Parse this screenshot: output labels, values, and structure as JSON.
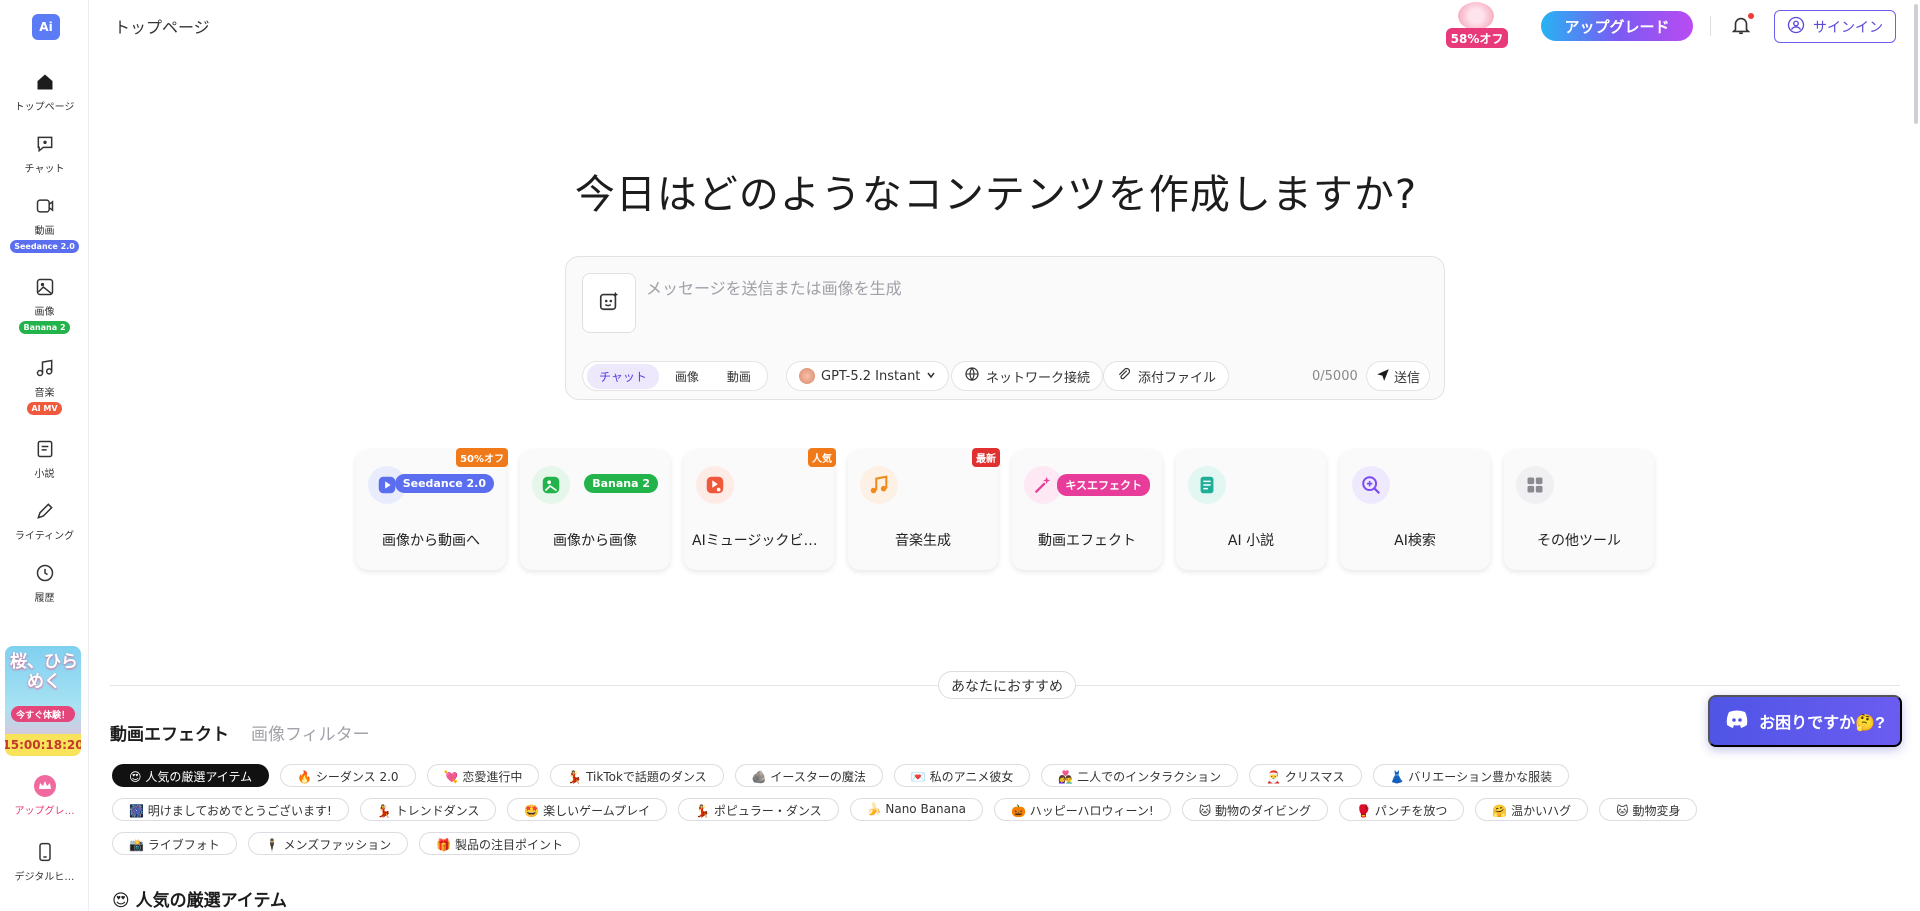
{
  "sidebar": {
    "logo": "Ai",
    "items": [
      {
        "label": "トップページ",
        "icon": "home-icon"
      },
      {
        "label": "チャット",
        "icon": "chat-icon"
      },
      {
        "label": "動画",
        "icon": "video-icon",
        "badge": "Seedance 2.0",
        "badge_color": "#5b6ef0"
      },
      {
        "label": "画像",
        "icon": "image-icon",
        "badge": "Banana 2",
        "badge_color": "#22b34a"
      },
      {
        "label": "音楽",
        "icon": "music-icon",
        "badge": "AI MV",
        "badge_color": "#f05a3c"
      },
      {
        "label": "小説",
        "icon": "novel-icon"
      },
      {
        "label": "ライティング",
        "icon": "pen-icon"
      },
      {
        "label": "履歴",
        "icon": "history-icon"
      },
      {
        "label": "アップグレード",
        "icon": "crown-icon"
      },
      {
        "label": "デジタルヒューマン",
        "icon": "phone-icon"
      }
    ],
    "promo": {
      "title": "桜、ひらめく",
      "cta": "今すぐ体験！",
      "timer": "15:00:18:20"
    }
  },
  "topbar": {
    "title": "トップページ",
    "sale": "58%オフ",
    "upgrade": "アップグレード",
    "signin": "サインイン"
  },
  "hero": {
    "title": "今日はどのようなコンテンツを作成しますか?"
  },
  "composer": {
    "placeholder": "メッセージを送信または画像を生成",
    "modes": [
      "チャット",
      "画像",
      "動画"
    ],
    "active_mode": "チャット",
    "model": "GPT-5.2 Instant",
    "network": "ネットワーク接続",
    "attach": "添付ファイル",
    "counter": "0/5000",
    "send": "送信"
  },
  "tools": [
    {
      "label": "画像から動画へ",
      "icon": "play-icon",
      "icon_bg": "#e9ecfd",
      "icon_color": "#5b6ef0",
      "pill": "Seedance 2.0",
      "pill_color": "#5b6ef0",
      "corner": "50%オフ",
      "corner_color": "#f07a1a"
    },
    {
      "label": "画像から画像",
      "icon": "image-edit-icon",
      "icon_bg": "#e5f6ea",
      "icon_color": "#22b34a",
      "pill": "Banana 2",
      "pill_color": "#22b34a"
    },
    {
      "label": "AIミュージックビデオ",
      "icon": "music-video-icon",
      "icon_bg": "#fdebe6",
      "icon_color": "#f0583c",
      "corner": "人気",
      "corner_color": "#f07a1a"
    },
    {
      "label": "音楽生成",
      "icon": "note-icon",
      "icon_bg": "#fdf0e4",
      "icon_color": "#f08a1a",
      "corner": "最新",
      "corner_color": "#e03030"
    },
    {
      "label": "動画エフェクト",
      "icon": "magic-wand-icon",
      "icon_bg": "#fde8f3",
      "icon_color": "#e83c9a",
      "pill": "キスエフェクト",
      "pill_color": "#e83c9a"
    },
    {
      "label": "AI 小説",
      "icon": "book-icon",
      "icon_bg": "#e2f6f2",
      "icon_color": "#1fae98"
    },
    {
      "label": "AI検索",
      "icon": "search-plus-icon",
      "icon_bg": "#efe9fd",
      "icon_color": "#7a4cf0"
    },
    {
      "label": "その他ツール",
      "icon": "grid-icon",
      "icon_bg": "#f0f0f2",
      "icon_color": "#8a8a92"
    }
  ],
  "recommend": {
    "label": "あなたにおすすめ",
    "tabs": [
      "動画エフェクト",
      "画像フィルター"
    ],
    "active_tab": "動画エフェクト",
    "chips": [
      "😍 人気の厳選アイテム",
      "🔥 シーダンス 2.0",
      "💘 恋愛進行中",
      "💃 TikTokで話題のダンス",
      "🪨 イースターの魔法",
      "💌 私のアニメ彼女",
      "👩‍❤️‍👨 二人でのインタラクション",
      "🎅 クリスマス",
      "👗 バリエーション豊かな服装",
      "🎆 明けましておめでとうございます!",
      "💃 トレンドダンス",
      "🤩 楽しいゲームプレイ",
      "💃 ポピュラー・ダンス",
      "🍌 Nano Banana",
      "🎃 ハッピーハロウィーン!",
      "🐱 動物のダイビング",
      "🥊 パンチを放つ",
      "🤗 温かいハグ",
      "🐱 動物変身",
      "📸 ライブフォト",
      "🕴 メンズファッション",
      "🎁 製品の注目ポイント"
    ],
    "active_chip": 0,
    "section_title": "😍 人気の厳選アイテム"
  },
  "help": {
    "label": "お困りですか🤔?"
  }
}
